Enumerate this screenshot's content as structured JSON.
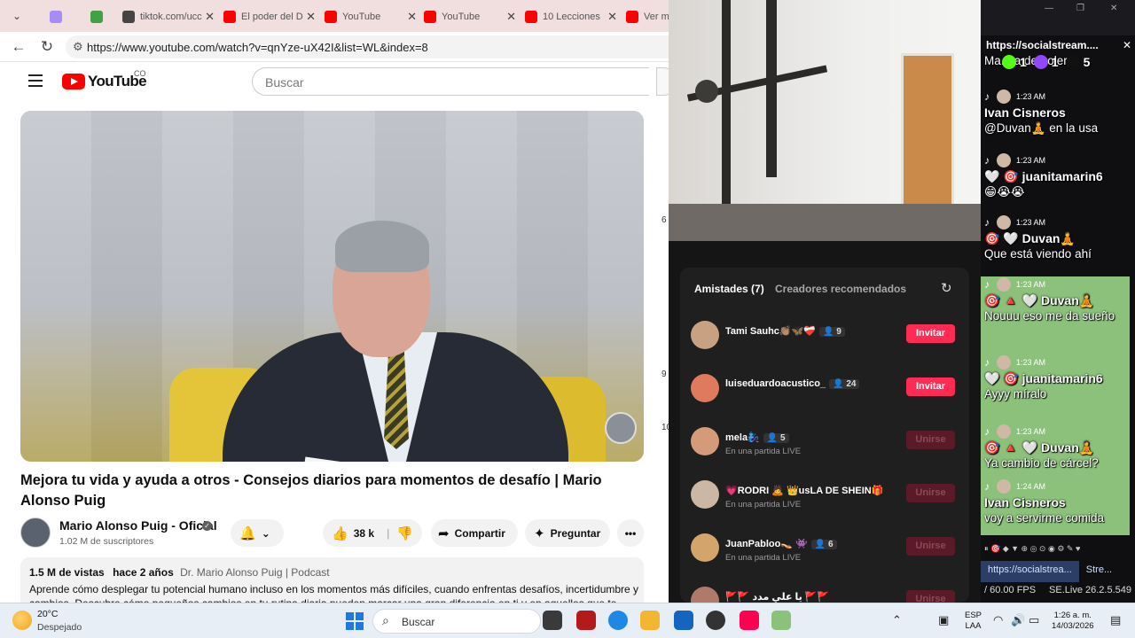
{
  "browser": {
    "tabs": [
      {
        "label": "",
        "color": "#a78bfa"
      },
      {
        "label": "",
        "color": "#43a047"
      },
      {
        "label": "tiktok.com/ucc",
        "color": "#444444"
      },
      {
        "label": "El poder del D",
        "color": "#ff0000"
      },
      {
        "label": "YouTube",
        "color": "#ff0000"
      },
      {
        "label": "YouTube",
        "color": "#ff0000"
      },
      {
        "label": "10 Lecciones",
        "color": "#ff0000"
      },
      {
        "label": "Ver más",
        "color": "#ff0000"
      }
    ],
    "url": "https://www.youtube.com/watch?v=qnYze-uX42I&list=WL&index=8"
  },
  "youtube": {
    "logo_text": "YouTube",
    "country_code": "CO",
    "search_placeholder": "Buscar",
    "video_title": "Mejora tu vida y ayuda a otros - Consejos diarios para momentos de desafío | Mario Alonso Puig",
    "channel_name": "Mario Alonso Puig - Oficial",
    "subscribers": "1.02 M de suscriptores",
    "likes": "38 k",
    "share_label": "Compartir",
    "ask_label": "Preguntar",
    "more_label": "•••",
    "views": "1.5 M de vistas",
    "age": "hace 2 años",
    "desc_tag": "Dr. Mario Alonso Puig | Podcast",
    "description": "Aprende cómo desplegar tu potencial humano incluso en los momentos más difíciles, cuando enfrentas desafíos, incertidumbre y cambios. Descubre cómo pequeños cambios en tu rutina diaria pueden marcar una gran diferencia en ti y en aquellos que te",
    "side_numbers": [
      "6",
      "9",
      "10"
    ]
  },
  "tiktok": {
    "tab_friends": "Amistades (7)",
    "tab_creators": "Creadores recomendados",
    "friends": [
      {
        "name": "Tami Sauhc👏🏽🦋❤️‍🩹",
        "count": "9",
        "sub": "",
        "button": "Invitar",
        "state": "invite",
        "avatar": "#c8a183"
      },
      {
        "name": "luiseduardoacustico_",
        "count": "24",
        "sub": "",
        "button": "Invitar",
        "state": "invite",
        "avatar": "#e07a5f"
      },
      {
        "name": "mela🧞‍♀️",
        "count": "5",
        "sub": "En una partida LIVE",
        "button": "Unirse",
        "state": "join",
        "avatar": "#d49a7a"
      },
      {
        "name": "💗RODRI 🙇 👑usLA DE SHEIN🎁",
        "count": "",
        "sub": "En una partida LIVE",
        "button": "Unirse",
        "state": "join",
        "avatar": "#cbb7a4"
      },
      {
        "name": "JuanPabloo👡 👾",
        "count": "6",
        "sub": "En una partida LIVE",
        "button": "Unirse",
        "state": "join",
        "avatar": "#d3a46b"
      },
      {
        "name": "🚩🚩 يا علي مدد 🚩🚩",
        "count": "",
        "sub": "",
        "button": "Unirse",
        "state": "join",
        "avatar": "#b07a6a"
      }
    ]
  },
  "chat": {
    "title": "https://socialstream....",
    "counts": [
      {
        "value": "1",
        "color": "#53fc18"
      },
      {
        "value": "1",
        "color": "#9146ff"
      },
      {
        "value": "5",
        "color": "#111111"
      }
    ],
    "messages": [
      {
        "time": "",
        "who": "",
        "body": "Ma... a demoler",
        "green": false
      },
      {
        "time": "1:23 AM",
        "who": "Ivan Cisneros",
        "body": "@Duvan🧘 en la usa",
        "green": false
      },
      {
        "time": "1:23 AM",
        "who": "🤍 🎯 juanitamarin6",
        "body": "😁😭😭",
        "green": false
      },
      {
        "time": "1:23 AM",
        "who": "🎯 🤍 Duvan🧘",
        "body": "Que está viendo ahí",
        "green": false
      },
      {
        "time": "1:23 AM",
        "who": "🎯 🔺 🤍 Duvan🧘",
        "body": "Nouuu eso me da sueño",
        "green": true
      },
      {
        "time": "1:23 AM",
        "who": "🤍 🎯 juanitamarin6",
        "body": "Ayyy míralo",
        "green": true
      },
      {
        "time": "1:23 AM",
        "who": "🎯 🔺 🤍 Duvan🧘",
        "body": "Ya cambio de cárcel?",
        "green": true
      },
      {
        "time": "1:24 AM",
        "who": "Ivan Cisneros",
        "body": "voy a servirme comida",
        "green": true
      }
    ],
    "tab_active": "https://socialstrea...",
    "tab_other": "Stre...",
    "fps": "/ 60.00 FPS",
    "version": "SE.Live 26.2.5.549"
  },
  "taskbar": {
    "temperature": "20°C",
    "weather": "Despejado",
    "search_placeholder": "Buscar",
    "lang": "ESP",
    "layout": "LAA",
    "time": "1:26 a. m.",
    "date": "14/03/2026"
  }
}
